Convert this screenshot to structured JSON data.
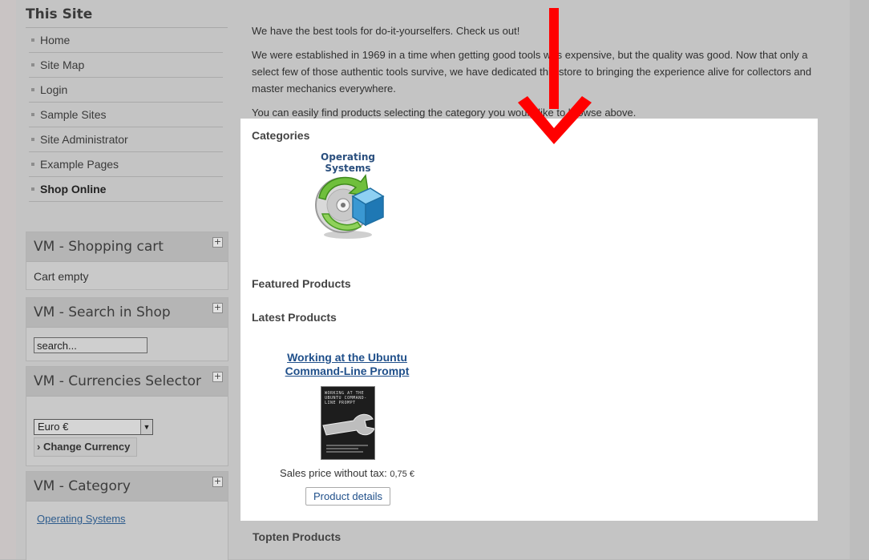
{
  "sidebar": {
    "title": "This Site",
    "items": [
      {
        "label": "Home"
      },
      {
        "label": "Site Map"
      },
      {
        "label": "Login"
      },
      {
        "label": "Sample Sites"
      },
      {
        "label": "Site Administrator"
      },
      {
        "label": "Example Pages"
      },
      {
        "label": "Shop Online",
        "active": true
      }
    ]
  },
  "modules": {
    "cart": {
      "title": "VM - Shopping cart",
      "toggle": "+",
      "status": "Cart empty"
    },
    "search": {
      "title": "VM - Search in Shop",
      "toggle": "+",
      "placeholder": "search..."
    },
    "currency": {
      "title": "VM - Currencies Selector",
      "toggle": "+",
      "selected": "Euro €",
      "button": "Change Currency",
      "button_prefix": "›"
    },
    "category": {
      "title": "VM - Category",
      "toggle": "+",
      "link": "Operating Systems"
    }
  },
  "intro": {
    "p1": "We have the best tools for do-it-yourselfers. Check us out!",
    "p2": "We were established in 1969 in a time when getting good tools was expensive, but the quality was good. Now that only a select few of those authentic tools survive, we have dedicated this store to bringing the experience alive for collectors and master mechanics everywhere.",
    "p3": "You can easily find products selecting the category you would like to browse above."
  },
  "sections": {
    "categories": "Categories",
    "featured": "Featured Products",
    "latest": "Latest Products",
    "topten": "Topten Products"
  },
  "category_card": {
    "name": "Operating Systems",
    "icon": "operating-systems-icon"
  },
  "product": {
    "name_line1": "Working at the Ubuntu",
    "name_line2": "Command-Line Prompt",
    "cover_text": "WORKING AT THE UBUNTU COMMAND-LINE PROMPT",
    "price_label": "Sales price without tax:",
    "price_value": "0,75 €",
    "details_button": "Product details"
  },
  "colors": {
    "arrow": "#ff0000",
    "link": "#1f4f8a",
    "highlight": "#ffffff"
  }
}
